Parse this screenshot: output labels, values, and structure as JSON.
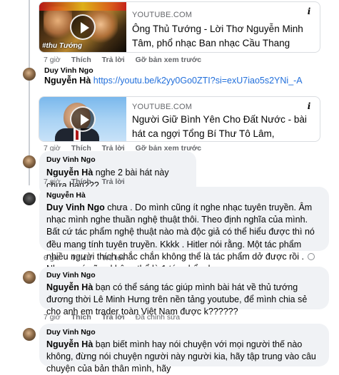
{
  "cards": [
    {
      "source": "YOUTUBE.COM",
      "title": "Ông Thủ Tướng - Lời Thơ Nguyễn Minh Tâm, phổ nhạc Ban nhạc Cầu Thang #thutuongphamminhchinh",
      "thumb_caption": "#thu Tướng"
    },
    {
      "source": "YOUTUBE.COM",
      "title": "Người Giữ Bình Yên Cho Đất Nước - bài hát ca ngợi Tổng Bí Thư Tô Lâm,"
    }
  ],
  "comments": [
    {
      "actions": [
        "7 giờ",
        "Thích",
        "Trả lời",
        "Gỡ bản xem trước"
      ]
    },
    {
      "author": "Duy Vinh Ngo",
      "mention": "Nguyễn Hà",
      "link": "https://youtu.be/k2yy0Go0ZTI?si=exU7iao5s2YNi_-A",
      "actions": [
        "7 giờ",
        "Thích",
        "Trả lời",
        "Gỡ bản xem trước"
      ]
    },
    {
      "author": "Duy Vinh Ngo",
      "mention": "Nguyễn Hà",
      "text": " nghe 2 bài hát này chưa bạn???",
      "actions": [
        "7 giờ",
        "Thích",
        "Trả lời"
      ]
    },
    {
      "author": "Nguyễn Hà",
      "mention": "Duy Vinh Ngo",
      "text": " chưa . Do mình cũng ít nghe nhạc tuyên truyền. Âm nhạc mình nghe thuần nghệ thuật thôi. Theo định nghĩa của mình. Bất cứ tác phẩm nghệ thuật nào mà độc giả có thể hiểu được thì nó đều mang tính tuyên truyền. Kkkk . Hitler nói rằng. Một tác phẩm nhiều người thích chắc chắn không thể là tác phẩm dở được rồi . Nhưng nó cũng không thể là 1 tác phẩm hay",
      "actions": [
        "6 giờ",
        "Thích",
        "Trả lời"
      ]
    },
    {
      "author": "Duy Vinh Ngo",
      "mention": "Nguyễn Hà",
      "text": " bạn có thể sáng tác giúp mình bài hát về thủ tướng đương thời Lê Minh Hưng trên nền tảng youtube, để mình chia sẻ cho anh em trader toàn Việt Nam được k??????",
      "actions": [
        "7 giờ",
        "Thích",
        "Trả lời",
        "Đã chỉnh sửa"
      ]
    },
    {
      "author": "Duy Vinh Ngo",
      "mention": "Nguyễn Hà",
      "text": " bạn biết mình hay nói chuyện với mọi người thế nào không, đừng nói chuyện người này người kia, hãy tập trung vào câu chuyện của bản thân mình, hãy"
    }
  ]
}
